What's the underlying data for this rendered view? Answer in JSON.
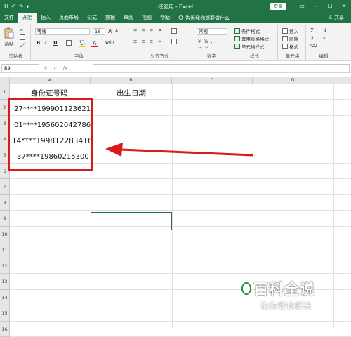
{
  "window": {
    "title": "经验用 - Excel",
    "login_label": "登录",
    "controls": [
      "▭",
      "—",
      "☐",
      "✕"
    ]
  },
  "quick_access": [
    "H",
    "↶",
    "↷",
    "▾"
  ],
  "tabs": [
    "文件",
    "开始",
    "插入",
    "页面布局",
    "公式",
    "数据",
    "审阅",
    "视图",
    "帮助"
  ],
  "active_tab": "开始",
  "tell_me": "告诉我你想要做什么",
  "share_label": "共享",
  "ribbon": {
    "clipboard": {
      "label": "剪贴板",
      "paste": "粘贴"
    },
    "font": {
      "label": "字体",
      "name": "等线",
      "size": "16",
      "grow": "A",
      "shrink": "A",
      "bold": "B",
      "italic": "I",
      "underline": "U",
      "wen": "wén"
    },
    "alignment": {
      "label": "对齐方式"
    },
    "number": {
      "label": "数字",
      "format": "常规"
    },
    "styles": {
      "label": "样式",
      "conditional": "条件格式",
      "table": "套用表格格式",
      "cell": "单元格样式"
    },
    "cells": {
      "label": "单元格",
      "insert": "插入",
      "delete": "删除",
      "format": "格式"
    },
    "editing": {
      "label": "编辑",
      "sigma": "Σ"
    }
  },
  "formula_bar": {
    "name_box": "B9",
    "cancel": "✕",
    "enter": "✓",
    "fx": "fx",
    "formula": ""
  },
  "columns": [
    "A",
    "B",
    "C",
    "D"
  ],
  "rows": [
    "1",
    "2",
    "3",
    "4",
    "5",
    "6",
    "7",
    "8",
    "9",
    "10",
    "11",
    "12",
    "13",
    "14",
    "15",
    "16"
  ],
  "cells": {
    "a1": "身份证号码",
    "b1": "出生日期",
    "a2": "27****199901123621",
    "a3": "01****195602042786",
    "a4": "14****199812283416",
    "a5": "37****19860215300"
  },
  "watermark": {
    "title": "百科全说",
    "subtitle": "助你轻松解决"
  },
  "colors": {
    "accent": "#217346",
    "annotation": "#d91a1a"
  }
}
